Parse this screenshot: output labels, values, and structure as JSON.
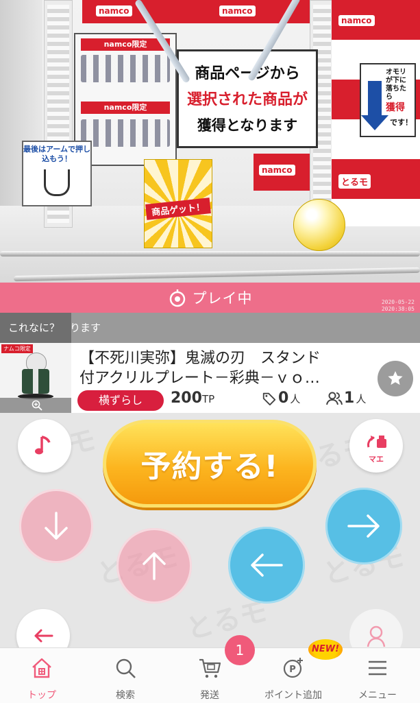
{
  "camera": {
    "main_sign": {
      "line1": "商品ページから",
      "line2": "選択された商品が",
      "line3": "獲得となります"
    },
    "namco_label": "namco",
    "namco_limited": "namco限定",
    "push_sign": "最後はアームで押し込もう！",
    "poster": "商品ゲット！",
    "right_sign": {
      "top": "オモリが下に落ちたら",
      "mid": "獲得",
      "bottom": "です！"
    },
    "torumo": "とるモ",
    "timestamp": "2020-05-22\n2020:38:05"
  },
  "status": {
    "play_text": "プレイ中"
  },
  "comment": {
    "text": "これなに？　ります"
  },
  "product": {
    "badge": "ナムコ限定",
    "title_line1": "【不死川実弥】鬼滅の刃　スタンド",
    "title_line2": "付アクリルプレート－彩典－ｖｏ…",
    "type": "横ずらし",
    "price": "200",
    "price_unit": "TP",
    "tags_count": "0",
    "tags_unit": "人",
    "players_count": "1",
    "players_unit": "人"
  },
  "controls": {
    "reserve_label": "予約する!",
    "mae_label": "マエ"
  },
  "nav": {
    "items": [
      {
        "label": "トップ",
        "icon": "home-icon"
      },
      {
        "label": "検索",
        "icon": "search-icon"
      },
      {
        "label": "発送",
        "icon": "cart-icon"
      },
      {
        "label": "ポイント追加",
        "icon": "points-icon"
      },
      {
        "label": "メニュー",
        "icon": "menu-icon"
      }
    ],
    "shipping_badge": "1",
    "new_badge": "NEW!"
  },
  "colors": {
    "accent_pink": "#f05a7a",
    "play_bar": "#ee6e8a",
    "reserve_orange": "#f9a818",
    "direction_blue": "#57bfe5",
    "brand_red": "#d81f2d"
  }
}
